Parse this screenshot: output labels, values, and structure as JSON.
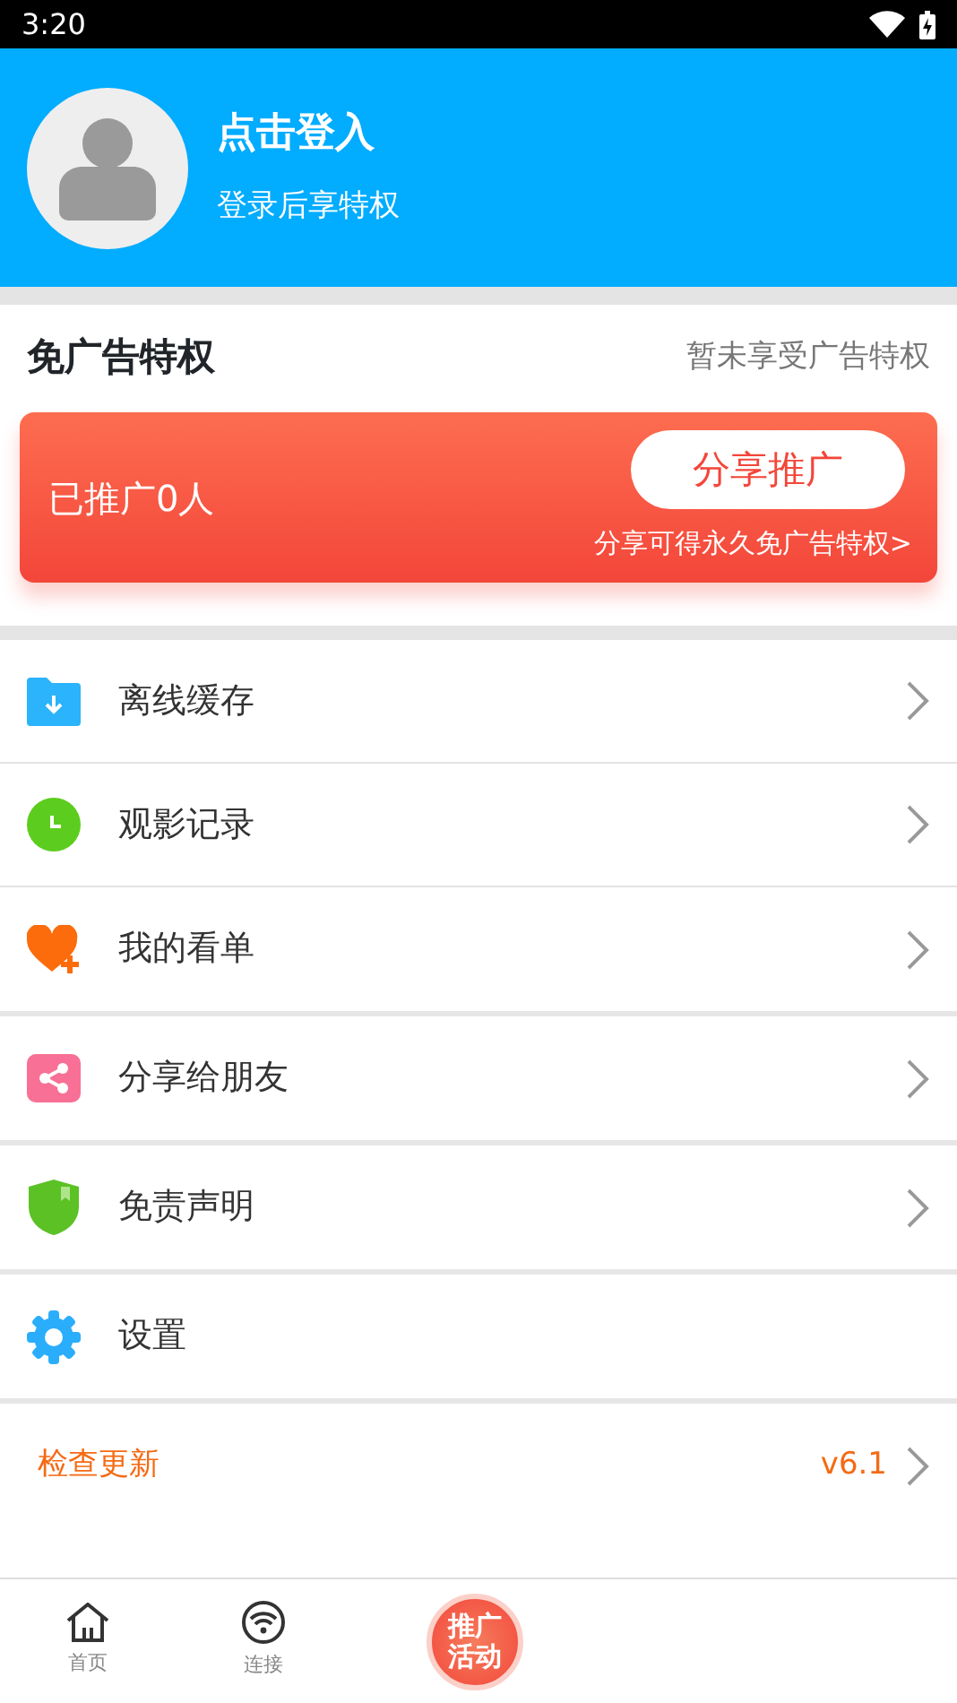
{
  "status_bar": {
    "time": "3:20"
  },
  "profile": {
    "title": "点击登入",
    "subtitle": "登录后享特权"
  },
  "ad_free": {
    "title": "免广告特权",
    "status": "暂未享受广告特权",
    "promoted": "已推广0人",
    "button": "分享推广",
    "hint": "分享可得永久免广告特权>"
  },
  "menu_groups": [
    [
      {
        "label": "离线缓存",
        "arrow": true
      },
      {
        "label": "观影记录",
        "arrow": true
      },
      {
        "label": "我的看单",
        "arrow": true
      }
    ],
    [
      {
        "label": "分享给朋友",
        "arrow": true
      }
    ],
    [
      {
        "label": "免责声明",
        "arrow": true
      }
    ],
    [
      {
        "label": "设置",
        "arrow": false
      }
    ]
  ],
  "update": {
    "label": "检查更新",
    "version": "v6.1"
  },
  "bottom_nav": [
    {
      "label": "首页"
    },
    {
      "label": "连接"
    }
  ],
  "promo_button": "推广活动"
}
